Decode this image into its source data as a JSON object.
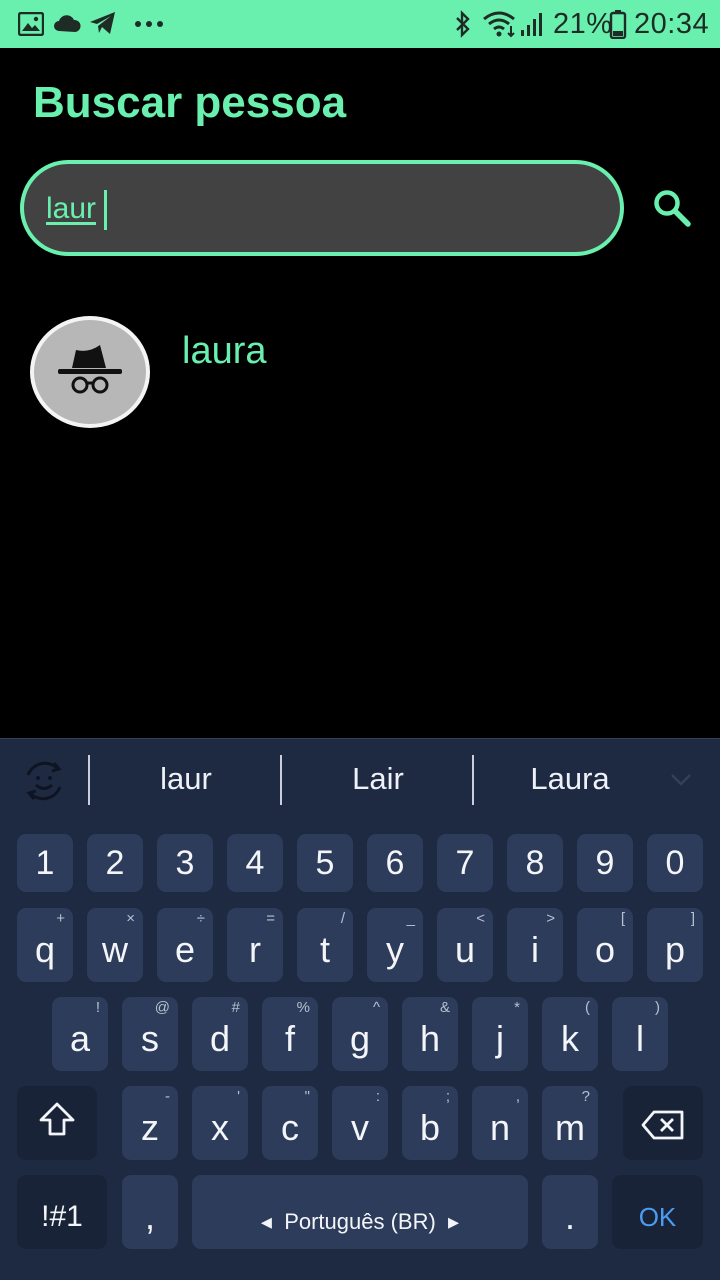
{
  "status": {
    "icons": [
      "image-icon",
      "cloud-icon",
      "telegram-icon",
      "more-dots-icon",
      "bluetooth-icon",
      "wifi-icon",
      "signal-icon",
      "battery-icon"
    ],
    "battery": "21%",
    "time": "20:34"
  },
  "header": {
    "title": "Buscar pessoa"
  },
  "search": {
    "value": "laur"
  },
  "results": [
    {
      "name": "laura",
      "avatar": "incognito-icon"
    }
  ],
  "keyboard": {
    "suggestions": [
      "laur",
      "Lair",
      "Laura"
    ],
    "numbers": [
      "1",
      "2",
      "3",
      "4",
      "5",
      "6",
      "7",
      "8",
      "9",
      "0"
    ],
    "row1": [
      {
        "k": "q",
        "h": "+"
      },
      {
        "k": "w",
        "h": "×"
      },
      {
        "k": "e",
        "h": "÷"
      },
      {
        "k": "r",
        "h": "="
      },
      {
        "k": "t",
        "h": "/"
      },
      {
        "k": "y",
        "h": "_"
      },
      {
        "k": "u",
        "h": "<"
      },
      {
        "k": "i",
        "h": ">"
      },
      {
        "k": "o",
        "h": "["
      },
      {
        "k": "p",
        "h": "]"
      }
    ],
    "row2": [
      {
        "k": "a",
        "h": "!"
      },
      {
        "k": "s",
        "h": "@"
      },
      {
        "k": "d",
        "h": "#"
      },
      {
        "k": "f",
        "h": "%"
      },
      {
        "k": "g",
        "h": "^"
      },
      {
        "k": "h",
        "h": "&"
      },
      {
        "k": "j",
        "h": "*"
      },
      {
        "k": "k",
        "h": "("
      },
      {
        "k": "l",
        "h": ")"
      }
    ],
    "row3": [
      {
        "k": "z",
        "h": "-"
      },
      {
        "k": "x",
        "h": "'"
      },
      {
        "k": "c",
        "h": "\""
      },
      {
        "k": "v",
        "h": ":"
      },
      {
        "k": "b",
        "h": ";"
      },
      {
        "k": "n",
        "h": ","
      },
      {
        "k": "m",
        "h": "?"
      }
    ],
    "symbols_label": "!#1",
    "comma": ",",
    "space_label": "Português (BR)",
    "period": ".",
    "ok_label": "OK"
  }
}
